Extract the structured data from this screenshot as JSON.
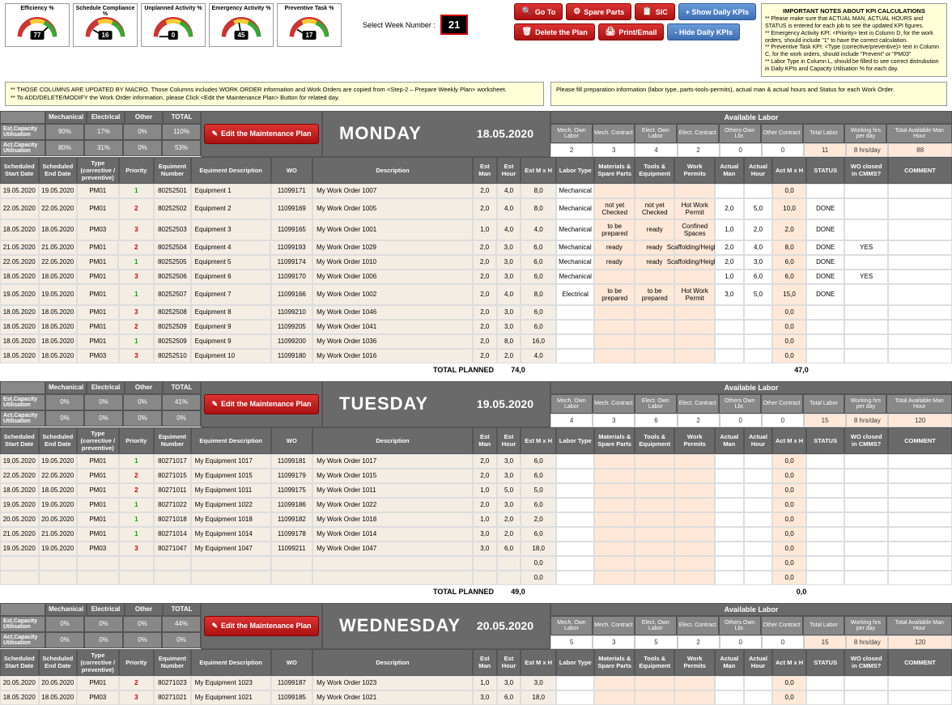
{
  "gauges": [
    {
      "title": "Efficiency %",
      "val": "77"
    },
    {
      "title": "Schedule Compliance %",
      "val": "16"
    },
    {
      "title": "Unplanned Activity %",
      "val": "0"
    },
    {
      "title": "Emergency Activity %",
      "val": "45"
    },
    {
      "title": "Preventive Task %",
      "val": "17"
    }
  ],
  "weekSel": {
    "label": "Select Week Number :",
    "value": "21"
  },
  "toolbar": {
    "goto": "Go To",
    "spare": "Spare Parts",
    "sic": "SIC",
    "show": "+ Show Daily KPIs",
    "delete": "Delete the Plan",
    "print": "Print/Email",
    "hide": "- Hide Daily KPIs"
  },
  "notes": {
    "title": "IMPORTANT NOTES ABOUT KPI CALCULATIONS",
    "l1": "** Please make sure that ACTUAL MAN, ACTUAL HOURS and STATUS is entered for each job to see the updated KPI figures.",
    "l2": "** Emergency Activity KPI: <Priority> text in Column D, for the work orders, should include \"1\" to have the correct calculation.",
    "l3": "** Preventive Task KPI: <Type (corrective/preventive)> text in Column C, for the work orders, should include \"Prevent\" or \"PM03\"",
    "l4": "** Labor Type in Column L, should be filled to see correct distrubution in Daily KPIs and Capacity Utilisation % for each day."
  },
  "macroNotes": {
    "left": "** THOSE COLUMNS ARE UPDATED BY MACRO. Those Columns includes WORK ORDER information and Work Orders are copied from <Step-2 – Prepare Weekly Plan> worksheet.\n** To ADD/DELETE/MODIFY the Work Order information, please Click <Edit the Maintenance Plan> Button for related day.",
    "right": "Please fill preparation information (labor type, parts-tools-permits), actual man & actual hours and Status for each Work Order."
  },
  "capCols": [
    "Mechanical",
    "Electrical",
    "Other",
    "TOTAL"
  ],
  "capRows": [
    "Est.Capacity Utilisation",
    "Act.Capacity Utilisation"
  ],
  "editBtn": "Edit the Maintenance Plan",
  "availHdr": "Available Labor",
  "availCols": [
    "Mech. Own Labor",
    "Mech. Contract",
    "Elect. Own Labor",
    "Elect. Contract",
    "Others Own Lbr.",
    "Other Contract",
    "Total Labor",
    "Working hrs per day",
    "Total Available Man Hour"
  ],
  "gridCols": [
    "Scheduled Start Date",
    "Scheduled End Date",
    "Type (corrective / preventive)",
    "Priority",
    "Equiment Number",
    "Equiment Description",
    "WO",
    "Description",
    "Est Man",
    "Est Hour",
    "Est M x H",
    "Labor Type",
    "Materials & Spare Parts",
    "Tools & Equipment",
    "Work Permits",
    "Actual Man",
    "Actual Hour",
    "Act M x H",
    "STATUS",
    "WO closed in CMMS?",
    "COMMENT"
  ],
  "totalLabel": "TOTAL PLANNED",
  "days": [
    {
      "name": "MONDAY",
      "date": "18.05.2020",
      "cap": [
        [
          "90%",
          "17%",
          "0%",
          "110%"
        ],
        [
          "80%",
          "31%",
          "0%",
          "53%"
        ]
      ],
      "avail": [
        "2",
        "3",
        "4",
        "2",
        "0",
        "0",
        "11",
        "8 hrs/day",
        "88"
      ],
      "totPlanned": "74,0",
      "totAct": "47,0",
      "rows": [
        [
          "19.05.2020",
          "19.05.2020",
          "PM01",
          "1",
          "80252501",
          "Equipment 1",
          "11099171",
          "My Work Order 1007",
          "2,0",
          "4,0",
          "8,0",
          "Mechanical",
          "",
          "",
          "",
          "",
          "",
          "0,0",
          "",
          "",
          ""
        ],
        [
          "22.05.2020",
          "22.05.2020",
          "PM01",
          "2",
          "80252502",
          "Equipment 2",
          "11099169",
          "My Work Order 1005",
          "2,0",
          "4,0",
          "8,0",
          "Mechanical",
          "not yet Checked",
          "not yet Checked",
          "Hot Work Permit",
          "2,0",
          "5,0",
          "10,0",
          "DONE",
          "",
          ""
        ],
        [
          "18.05.2020",
          "18.05.2020",
          "PM03",
          "3",
          "80252503",
          "Equipment 3",
          "11099165",
          "My Work Order 1001",
          "1,0",
          "4,0",
          "4,0",
          "Mechanical",
          "to be prepared",
          "ready",
          "Confined Spaces",
          "1,0",
          "2,0",
          "2,0",
          "DONE",
          "",
          ""
        ],
        [
          "21.05.2020",
          "21.05.2020",
          "PM01",
          "2",
          "80252504",
          "Equipment 4",
          "11099193",
          "My Work Order 1029",
          "2,0",
          "3,0",
          "6,0",
          "Mechanical",
          "ready",
          "ready",
          "Scaffolding/Heights",
          "2,0",
          "4,0",
          "8,0",
          "DONE",
          "YES",
          ""
        ],
        [
          "22.05.2020",
          "22.05.2020",
          "PM01",
          "1",
          "80252505",
          "Equipment 5",
          "11099174",
          "My Work Order 1010",
          "2,0",
          "3,0",
          "6,0",
          "Mechanical",
          "ready",
          "ready",
          "Scaffolding/Heights",
          "2,0",
          "3,0",
          "6,0",
          "DONE",
          "",
          ""
        ],
        [
          "18.05.2020",
          "18.05.2020",
          "PM01",
          "3",
          "80252506",
          "Equipment 6",
          "11099170",
          "My Work Order 1006",
          "2,0",
          "3,0",
          "6,0",
          "Mechanical",
          "",
          "",
          "",
          "1,0",
          "6,0",
          "6,0",
          "DONE",
          "YES",
          ""
        ],
        [
          "19.05.2020",
          "19.05.2020",
          "PM01",
          "1",
          "80252507",
          "Equipment 7",
          "11099166",
          "My Work Order 1002",
          "2,0",
          "4,0",
          "8,0",
          "Electrical",
          "to be prepared",
          "to be prepared",
          "Hot Work Permit",
          "3,0",
          "5,0",
          "15,0",
          "DONE",
          "",
          ""
        ],
        [
          "18.05.2020",
          "18.05.2020",
          "PM01",
          "3",
          "80252508",
          "Equipment 8",
          "11099210",
          "My Work Order 1046",
          "2,0",
          "3,0",
          "6,0",
          "",
          "",
          "",
          "",
          "",
          "",
          "0,0",
          "",
          "",
          ""
        ],
        [
          "18.05.2020",
          "18.05.2020",
          "PM01",
          "2",
          "80252509",
          "Equipment 9",
          "11099205",
          "My Work Order 1041",
          "2,0",
          "3,0",
          "6,0",
          "",
          "",
          "",
          "",
          "",
          "",
          "0,0",
          "",
          "",
          ""
        ],
        [
          "18.05.2020",
          "18.05.2020",
          "PM01",
          "1",
          "80252509",
          "Equipment 9",
          "11099200",
          "My Work Order 1036",
          "2,0",
          "8,0",
          "16,0",
          "",
          "",
          "",
          "",
          "",
          "",
          "0,0",
          "",
          "",
          ""
        ],
        [
          "18.05.2020",
          "18.05.2020",
          "PM03",
          "3",
          "80252510",
          "Equipment 10",
          "11099180",
          "My Work Order 1016",
          "2,0",
          "2,0",
          "4,0",
          "",
          "",
          "",
          "",
          "",
          "",
          "0,0",
          "",
          "",
          ""
        ]
      ]
    },
    {
      "name": "TUESDAY",
      "date": "19.05.2020",
      "cap": [
        [
          "0%",
          "0%",
          "0%",
          "41%"
        ],
        [
          "0%",
          "0%",
          "0%",
          "0%"
        ]
      ],
      "avail": [
        "4",
        "3",
        "6",
        "2",
        "0",
        "0",
        "15",
        "8 hrs/day",
        "120"
      ],
      "totPlanned": "49,0",
      "totAct": "0,0",
      "rows": [
        [
          "19.05.2020",
          "19.05.2020",
          "PM01",
          "1",
          "80271017",
          "My Equipment 1017",
          "11099181",
          "My Work Order 1017",
          "2,0",
          "3,0",
          "6,0",
          "",
          "",
          "",
          "",
          "",
          "",
          "0,0",
          "",
          "",
          ""
        ],
        [
          "22.05.2020",
          "22.05.2020",
          "PM01",
          "2",
          "80271015",
          "My Equipment 1015",
          "11099179",
          "My Work Order 1015",
          "2,0",
          "3,0",
          "6,0",
          "",
          "",
          "",
          "",
          "",
          "",
          "0,0",
          "",
          "",
          ""
        ],
        [
          "18.05.2020",
          "18.05.2020",
          "PM01",
          "2",
          "80271011",
          "My Equipment 1011",
          "11099175",
          "My Work Order 1011",
          "1,0",
          "5,0",
          "5,0",
          "",
          "",
          "",
          "",
          "",
          "",
          "0,0",
          "",
          "",
          ""
        ],
        [
          "19.05.2020",
          "19.05.2020",
          "PM01",
          "1",
          "80271022",
          "My Equipment 1022",
          "11099186",
          "My Work Order 1022",
          "2,0",
          "3,0",
          "6,0",
          "",
          "",
          "",
          "",
          "",
          "",
          "0,0",
          "",
          "",
          ""
        ],
        [
          "20.05.2020",
          "20.05.2020",
          "PM01",
          "1",
          "80271018",
          "My Equipment 1018",
          "11099182",
          "My Work Order 1018",
          "1,0",
          "2,0",
          "2,0",
          "",
          "",
          "",
          "",
          "",
          "",
          "0,0",
          "",
          "",
          ""
        ],
        [
          "21.05.2020",
          "21.05.2020",
          "PM01",
          "1",
          "80271014",
          "My Equipment 1014",
          "11099178",
          "My Work Order 1014",
          "3,0",
          "2,0",
          "6,0",
          "",
          "",
          "",
          "",
          "",
          "",
          "0,0",
          "",
          "",
          ""
        ],
        [
          "19.05.2020",
          "19.05.2020",
          "PM03",
          "3",
          "80271047",
          "My Equipment 1047",
          "11099211",
          "My Work Order 1047",
          "3,0",
          "6,0",
          "18,0",
          "",
          "",
          "",
          "",
          "",
          "",
          "0,0",
          "",
          "",
          ""
        ],
        [
          "",
          "",
          "",
          "",
          "",
          "",
          "",
          "",
          "",
          "",
          "0,0",
          "",
          "",
          "",
          "",
          "",
          "",
          "0,0",
          "",
          "",
          ""
        ],
        [
          "",
          "",
          "",
          "",
          "",
          "",
          "",
          "",
          "",
          "",
          "0,0",
          "",
          "",
          "",
          "",
          "",
          "",
          "0,0",
          "",
          "",
          ""
        ]
      ]
    },
    {
      "name": "WEDNESDAY",
      "date": "20.05.2020",
      "cap": [
        [
          "0%",
          "0%",
          "0%",
          "44%"
        ],
        [
          "0%",
          "0%",
          "0%",
          "0%"
        ]
      ],
      "avail": [
        "5",
        "3",
        "5",
        "2",
        "0",
        "0",
        "15",
        "8 hrs/day",
        "120"
      ],
      "totPlanned": "",
      "totAct": "",
      "rows": [
        [
          "20.05.2020",
          "20.05.2020",
          "PM01",
          "2",
          "80271023",
          "My Equipment 1023",
          "11099187",
          "My Work Order 1023",
          "1,0",
          "3,0",
          "3,0",
          "",
          "",
          "",
          "",
          "",
          "",
          "0,0",
          "",
          "",
          ""
        ],
        [
          "18.05.2020",
          "18.05.2020",
          "PM03",
          "3",
          "80271021",
          "My Equipment 1021",
          "11099185",
          "My Work Order 1021",
          "3,0",
          "6,0",
          "18,0",
          "",
          "",
          "",
          "",
          "",
          "",
          "0,0",
          "",
          "",
          ""
        ]
      ]
    }
  ]
}
